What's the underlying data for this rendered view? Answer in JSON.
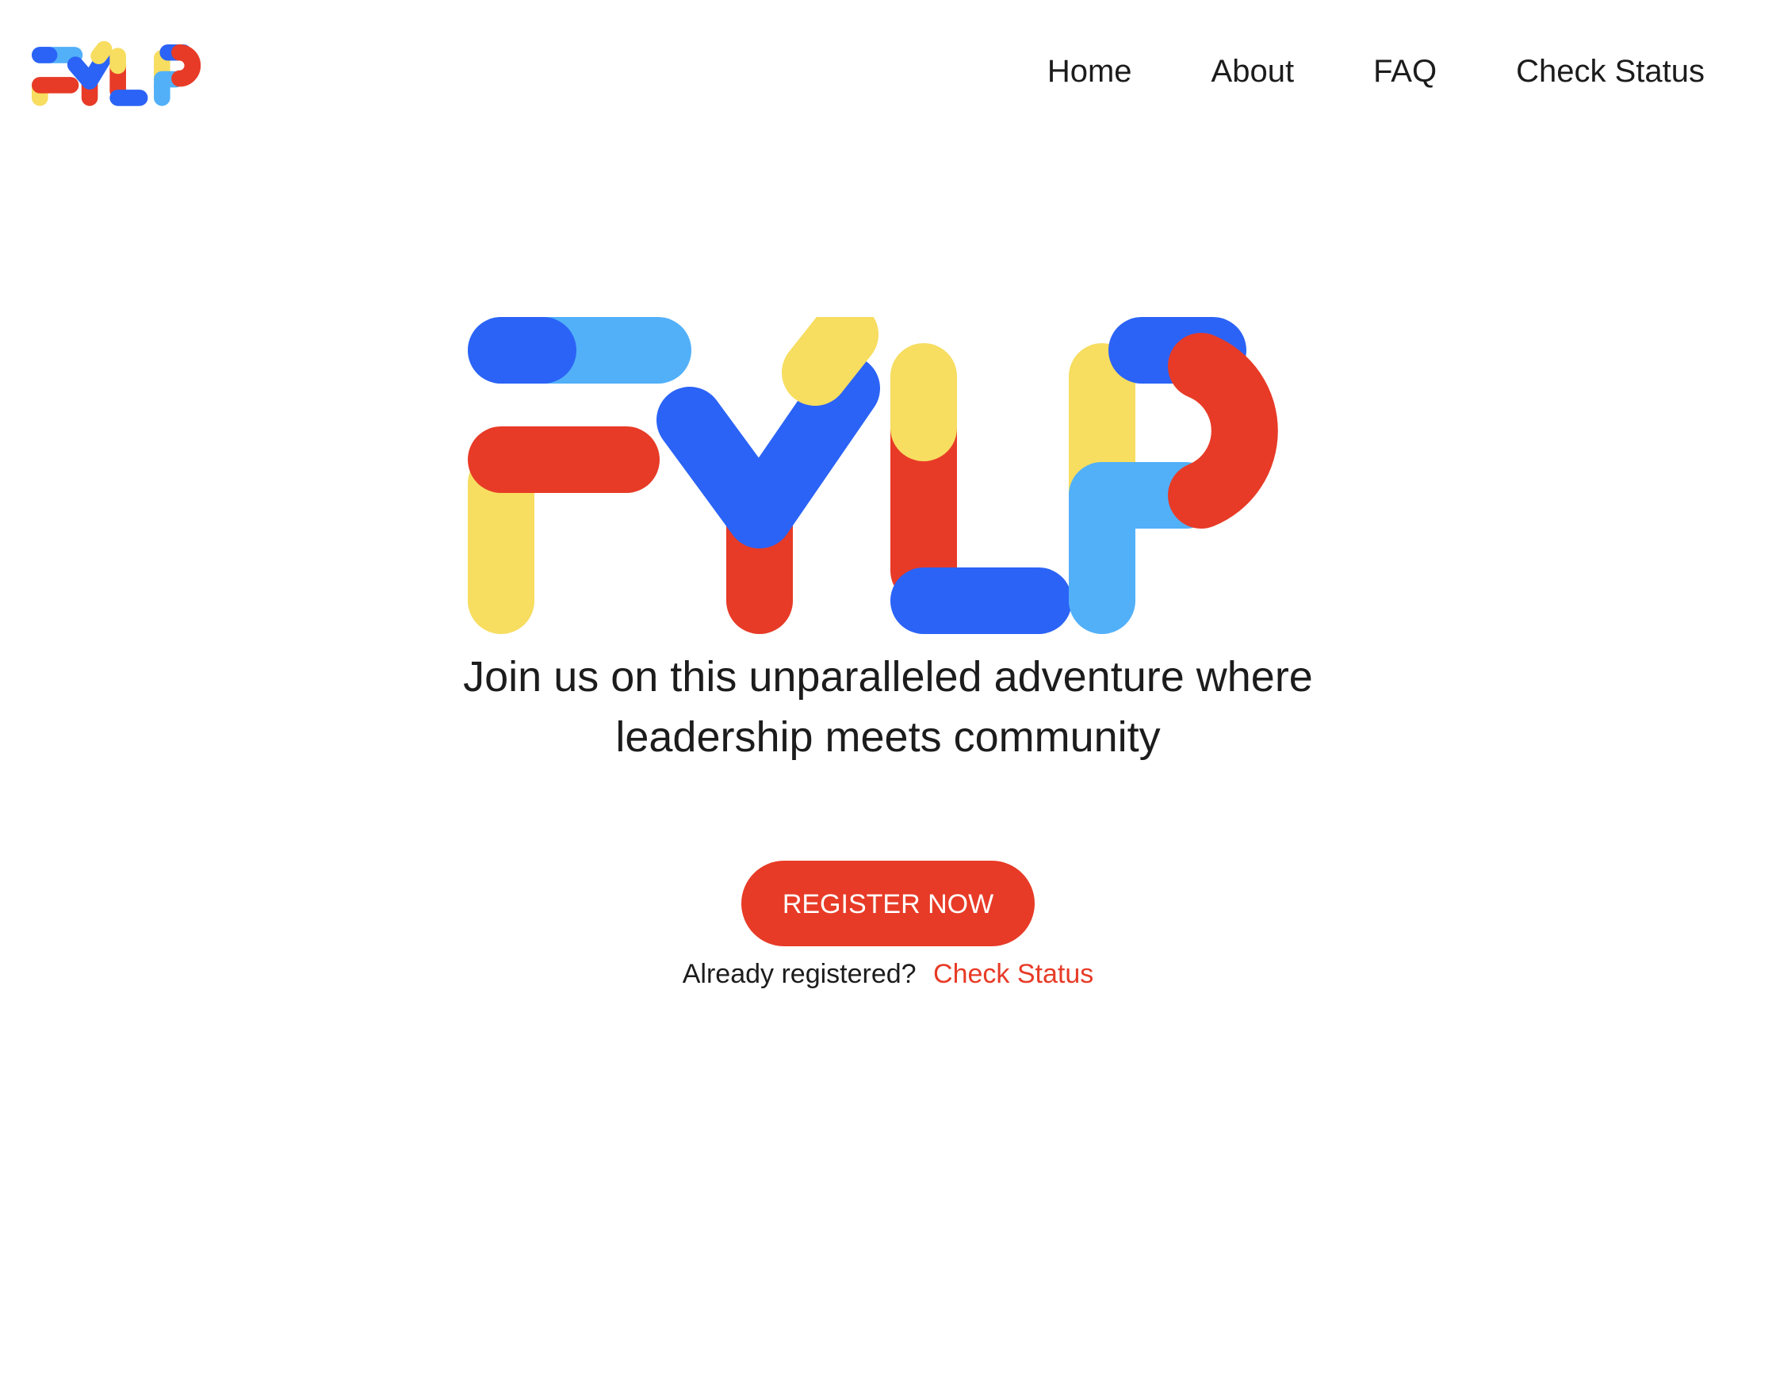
{
  "brand": {
    "logo_text": "FYLP",
    "colors": {
      "blue": "#2b63f6",
      "light_blue": "#52b0f9",
      "red": "#e73b27",
      "yellow": "#f7dd60"
    }
  },
  "nav": {
    "items": [
      {
        "label": "Home"
      },
      {
        "label": "About"
      },
      {
        "label": "FAQ"
      },
      {
        "label": "Check Status"
      }
    ]
  },
  "hero": {
    "tagline_line1": "Join us on this unparalleled adventure where",
    "tagline_line2": "leadership meets community",
    "register_label": "REGISTER NOW",
    "already_text": "Already registered?",
    "check_status_link": "Check Status"
  }
}
